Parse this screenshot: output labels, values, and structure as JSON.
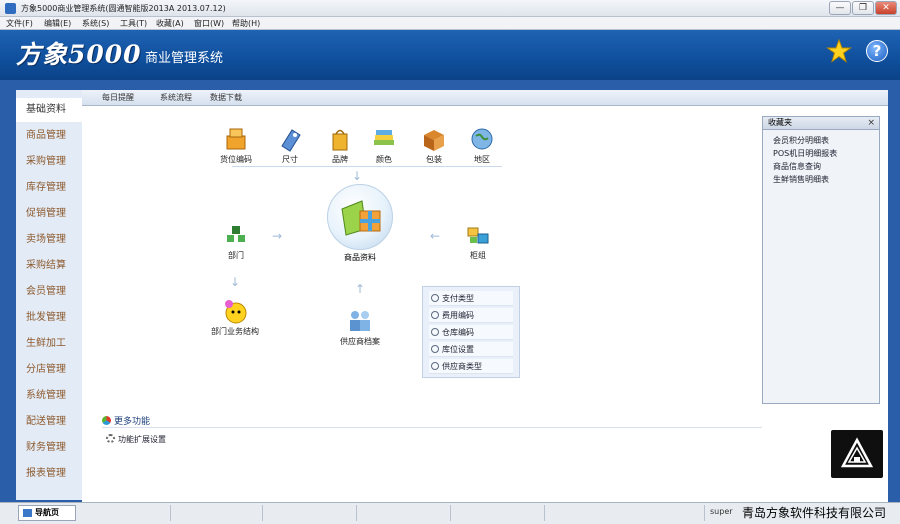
{
  "window": {
    "title": "方象5000商业管理系统(圆通智能版2013A 2013.07.12)",
    "minimize": "—",
    "restore": "❐",
    "close": "✕"
  },
  "menu": [
    "文件(F)",
    "编辑(E)",
    "系统(S)",
    "工具(T)",
    "收藏(A)",
    "窗口(W)",
    "帮助(H)"
  ],
  "banner": {
    "brand": "方象5000",
    "subtitle": "商业管理系统",
    "help": "?"
  },
  "sidebar": {
    "items": [
      "基础资料",
      "商品管理",
      "采购管理",
      "库存管理",
      "促销管理",
      "卖场管理",
      "采购结算",
      "会员管理",
      "批发管理",
      "生鲜加工",
      "分店管理",
      "系统管理",
      "配送管理",
      "财务管理",
      "报表管理"
    ]
  },
  "tabs": [
    "每日提醒",
    "系统流程",
    "数据下载"
  ],
  "flow": {
    "top_nodes": [
      "货位编码",
      "尺寸",
      "品牌",
      "颜色",
      "包装",
      "地区"
    ],
    "left_node": "部门",
    "center_node": "商品资料",
    "right_node": "柜组",
    "bottom_left_node": "部门业务结构",
    "bottom_center_node": "供应商档案"
  },
  "query_panel": {
    "items": [
      "支付类型",
      "费用编码",
      "仓库编码",
      "库位设置",
      "供应商类型"
    ]
  },
  "favorites": {
    "title": "收藏夹",
    "close": "×",
    "items": [
      "会员积分明细表",
      "POS机日明细报表",
      "商品信息查询",
      "生鲜销售明细表"
    ]
  },
  "more": {
    "label": "更多功能",
    "link": "功能扩展设置"
  },
  "status": {
    "tab": "导航页",
    "user": "super",
    "company": "青岛方象软件科技有限公司"
  },
  "colors": {
    "banner": "#1f63b4",
    "frame": "#2a5ea8",
    "sidebar_text": "#8d5a2e"
  }
}
